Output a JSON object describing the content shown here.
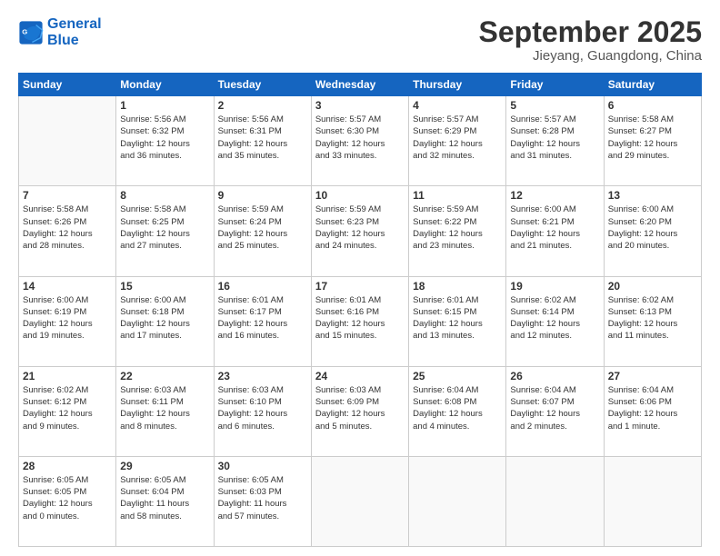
{
  "header": {
    "logo_line1": "General",
    "logo_line2": "Blue",
    "main_title": "September 2025",
    "subtitle": "Jieyang, Guangdong, China"
  },
  "days_of_week": [
    "Sunday",
    "Monday",
    "Tuesday",
    "Wednesday",
    "Thursday",
    "Friday",
    "Saturday"
  ],
  "weeks": [
    [
      {
        "day": "",
        "info": ""
      },
      {
        "day": "1",
        "info": "Sunrise: 5:56 AM\nSunset: 6:32 PM\nDaylight: 12 hours\nand 36 minutes."
      },
      {
        "day": "2",
        "info": "Sunrise: 5:56 AM\nSunset: 6:31 PM\nDaylight: 12 hours\nand 35 minutes."
      },
      {
        "day": "3",
        "info": "Sunrise: 5:57 AM\nSunset: 6:30 PM\nDaylight: 12 hours\nand 33 minutes."
      },
      {
        "day": "4",
        "info": "Sunrise: 5:57 AM\nSunset: 6:29 PM\nDaylight: 12 hours\nand 32 minutes."
      },
      {
        "day": "5",
        "info": "Sunrise: 5:57 AM\nSunset: 6:28 PM\nDaylight: 12 hours\nand 31 minutes."
      },
      {
        "day": "6",
        "info": "Sunrise: 5:58 AM\nSunset: 6:27 PM\nDaylight: 12 hours\nand 29 minutes."
      }
    ],
    [
      {
        "day": "7",
        "info": "Sunrise: 5:58 AM\nSunset: 6:26 PM\nDaylight: 12 hours\nand 28 minutes."
      },
      {
        "day": "8",
        "info": "Sunrise: 5:58 AM\nSunset: 6:25 PM\nDaylight: 12 hours\nand 27 minutes."
      },
      {
        "day": "9",
        "info": "Sunrise: 5:59 AM\nSunset: 6:24 PM\nDaylight: 12 hours\nand 25 minutes."
      },
      {
        "day": "10",
        "info": "Sunrise: 5:59 AM\nSunset: 6:23 PM\nDaylight: 12 hours\nand 24 minutes."
      },
      {
        "day": "11",
        "info": "Sunrise: 5:59 AM\nSunset: 6:22 PM\nDaylight: 12 hours\nand 23 minutes."
      },
      {
        "day": "12",
        "info": "Sunrise: 6:00 AM\nSunset: 6:21 PM\nDaylight: 12 hours\nand 21 minutes."
      },
      {
        "day": "13",
        "info": "Sunrise: 6:00 AM\nSunset: 6:20 PM\nDaylight: 12 hours\nand 20 minutes."
      }
    ],
    [
      {
        "day": "14",
        "info": "Sunrise: 6:00 AM\nSunset: 6:19 PM\nDaylight: 12 hours\nand 19 minutes."
      },
      {
        "day": "15",
        "info": "Sunrise: 6:00 AM\nSunset: 6:18 PM\nDaylight: 12 hours\nand 17 minutes."
      },
      {
        "day": "16",
        "info": "Sunrise: 6:01 AM\nSunset: 6:17 PM\nDaylight: 12 hours\nand 16 minutes."
      },
      {
        "day": "17",
        "info": "Sunrise: 6:01 AM\nSunset: 6:16 PM\nDaylight: 12 hours\nand 15 minutes."
      },
      {
        "day": "18",
        "info": "Sunrise: 6:01 AM\nSunset: 6:15 PM\nDaylight: 12 hours\nand 13 minutes."
      },
      {
        "day": "19",
        "info": "Sunrise: 6:02 AM\nSunset: 6:14 PM\nDaylight: 12 hours\nand 12 minutes."
      },
      {
        "day": "20",
        "info": "Sunrise: 6:02 AM\nSunset: 6:13 PM\nDaylight: 12 hours\nand 11 minutes."
      }
    ],
    [
      {
        "day": "21",
        "info": "Sunrise: 6:02 AM\nSunset: 6:12 PM\nDaylight: 12 hours\nand 9 minutes."
      },
      {
        "day": "22",
        "info": "Sunrise: 6:03 AM\nSunset: 6:11 PM\nDaylight: 12 hours\nand 8 minutes."
      },
      {
        "day": "23",
        "info": "Sunrise: 6:03 AM\nSunset: 6:10 PM\nDaylight: 12 hours\nand 6 minutes."
      },
      {
        "day": "24",
        "info": "Sunrise: 6:03 AM\nSunset: 6:09 PM\nDaylight: 12 hours\nand 5 minutes."
      },
      {
        "day": "25",
        "info": "Sunrise: 6:04 AM\nSunset: 6:08 PM\nDaylight: 12 hours\nand 4 minutes."
      },
      {
        "day": "26",
        "info": "Sunrise: 6:04 AM\nSunset: 6:07 PM\nDaylight: 12 hours\nand 2 minutes."
      },
      {
        "day": "27",
        "info": "Sunrise: 6:04 AM\nSunset: 6:06 PM\nDaylight: 12 hours\nand 1 minute."
      }
    ],
    [
      {
        "day": "28",
        "info": "Sunrise: 6:05 AM\nSunset: 6:05 PM\nDaylight: 12 hours\nand 0 minutes."
      },
      {
        "day": "29",
        "info": "Sunrise: 6:05 AM\nSunset: 6:04 PM\nDaylight: 11 hours\nand 58 minutes."
      },
      {
        "day": "30",
        "info": "Sunrise: 6:05 AM\nSunset: 6:03 PM\nDaylight: 11 hours\nand 57 minutes."
      },
      {
        "day": "",
        "info": ""
      },
      {
        "day": "",
        "info": ""
      },
      {
        "day": "",
        "info": ""
      },
      {
        "day": "",
        "info": ""
      }
    ]
  ]
}
